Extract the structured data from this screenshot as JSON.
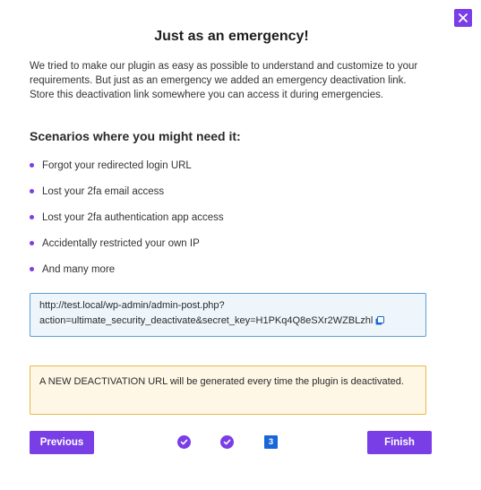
{
  "dialog": {
    "title": "Just as an emergency!",
    "intro_line1": "We tried to make our plugin as easy as possible to understand and customize to your requirements. But just as an emergency we added an emergency deactivation link.",
    "intro_line2": "Store this deactivation link somewhere you can access it during emergencies.",
    "scenarios_title": "Scenarios where you might need it:",
    "scenarios": [
      "Forgot your redirected login URL",
      "Lost your 2fa email access",
      "Lost your 2fa authentication app access",
      "Accidentally restricted your own IP",
      "And many more"
    ],
    "deactivation_url_line1": "http://test.local/wp-admin/admin-post.php?",
    "deactivation_url_line2": "action=ultimate_security_deactivate&secret_key=H1PKq4Q8eSXr2WZBLzhl",
    "notice": "A NEW DEACTIVATION URL will be generated every time the plugin is deactivated."
  },
  "footer": {
    "previous_label": "Previous",
    "finish_label": "Finish",
    "steps": [
      {
        "state": "complete",
        "icon": "check-icon"
      },
      {
        "state": "complete",
        "icon": "check-icon"
      },
      {
        "state": "current",
        "label": "3"
      }
    ]
  },
  "colors": {
    "accent": "#7a3ee6",
    "current_step": "#1a66d9",
    "url_box_bg": "#eef6fc",
    "url_box_border": "#5aa0d8",
    "notice_bg": "#fff7e6",
    "notice_border": "#e8b84a"
  }
}
